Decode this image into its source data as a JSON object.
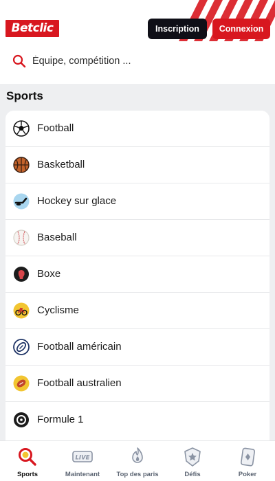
{
  "header": {
    "logo_text": "Betclic",
    "inscription_label": "Inscription",
    "connexion_label": "Connexion",
    "search_placeholder": "Équipe, compétition ..."
  },
  "colors": {
    "brand_red": "#d8171f",
    "dark_button": "#0f0f17",
    "background": "#eeeff1"
  },
  "sports": {
    "title": "Sports",
    "items": [
      {
        "label": "Football",
        "icon": "football-icon"
      },
      {
        "label": "Basketball",
        "icon": "basketball-icon"
      },
      {
        "label": "Hockey sur glace",
        "icon": "ice-hockey-icon"
      },
      {
        "label": "Baseball",
        "icon": "baseball-icon"
      },
      {
        "label": "Boxe",
        "icon": "boxing-icon"
      },
      {
        "label": "Cyclisme",
        "icon": "cycling-icon"
      },
      {
        "label": "Football américain",
        "icon": "american-football-icon"
      },
      {
        "label": "Football australien",
        "icon": "australian-football-icon"
      },
      {
        "label": "Formule 1",
        "icon": "formula-1-icon"
      }
    ]
  },
  "bottom_nav": {
    "items": [
      {
        "label": "Sports",
        "icon": "sports-search-icon",
        "active": true
      },
      {
        "label": "Maintenant",
        "icon": "live-icon",
        "badge": "LIVE"
      },
      {
        "label": "Top des paris",
        "icon": "flame-icon"
      },
      {
        "label": "Défis",
        "icon": "star-shield-icon"
      },
      {
        "label": "Poker",
        "icon": "playing-card-icon"
      }
    ]
  }
}
